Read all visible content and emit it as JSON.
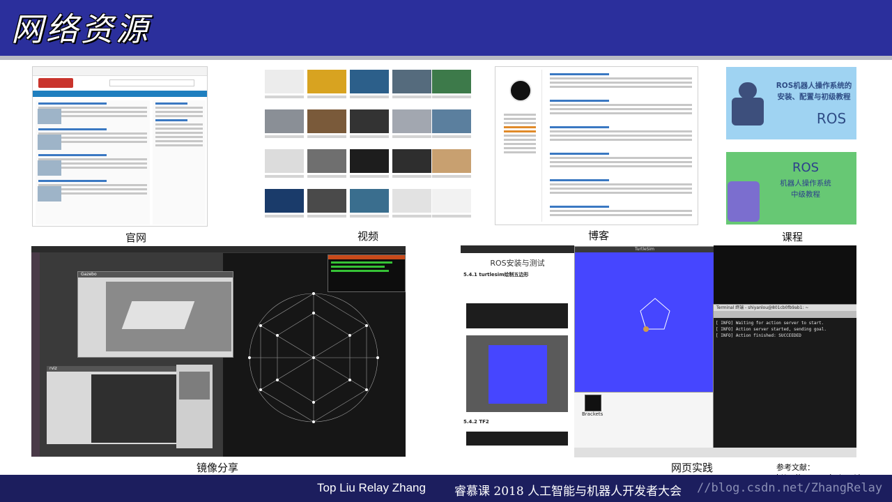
{
  "slide": {
    "title": "网络资源",
    "captions": {
      "official_site": "官网",
      "videos": "视频",
      "blog": "博客",
      "courses": "课程",
      "mirror_share": "镜像分享",
      "web_practice": "网页实践"
    },
    "reference": "参考文献：http://www.exbot.net/",
    "footer": {
      "authors": "Top Liu  Relay Zhang",
      "event": "睿慕课 2018 人工智能与机器人开发者大会",
      "watermark": "//blog.csdn.net/ZhangRelay"
    }
  },
  "thumbnails": {
    "course1": {
      "line1": "ROS机器人操作系统的",
      "line2": "安装、配置与初级教程",
      "brand": "ROS"
    },
    "course2": {
      "brand": "ROS",
      "line1": "机器人操作系统",
      "line2": "中级教程"
    },
    "practice": {
      "doc_title": "ROS安装与测试",
      "section1": "5.4.1 turtlesim绘制五边形",
      "section2": "5.4.2 TF2",
      "window_title": "TurtleSim",
      "terminal_title": "Terminal 终端 - shiyanlou@801cb0fb9ab1: ~",
      "log1": "[ INFO] Waiting for action server to start.",
      "log2": "[ INFO] Action server started, sending goal.",
      "log3": "[ INFO] Action finished: SUCCEEDED",
      "brackets": "Brackets"
    },
    "mirror": {
      "gazebo": "Gazebo",
      "rviz": "rviz"
    }
  },
  "colors": {
    "header": "#2b2f9c",
    "footer": "#1c1e5e",
    "course1_bg": "#9fd3f2",
    "course2_bg": "#67c874",
    "turtle_bg": "#4646ff"
  }
}
